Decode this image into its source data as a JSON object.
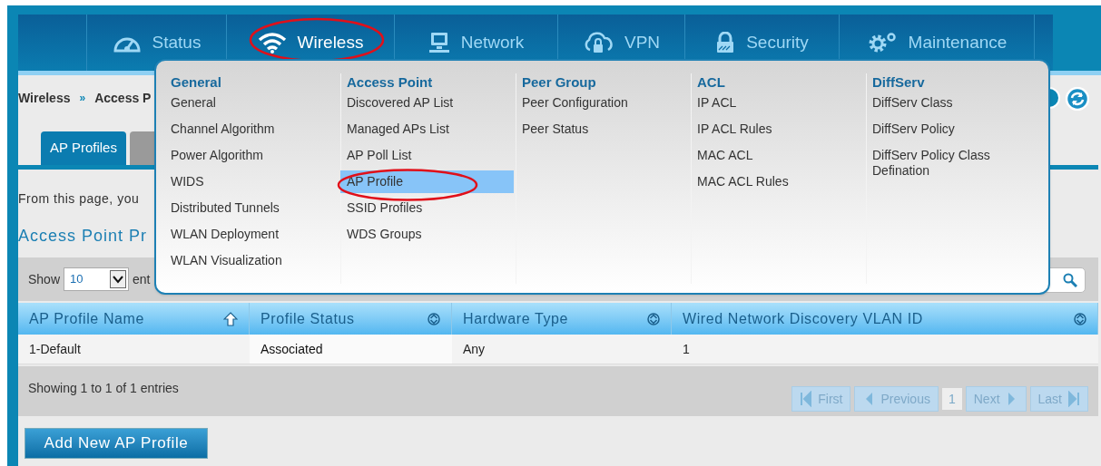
{
  "nav": [
    {
      "label": "Status",
      "selected": false,
      "circled": false
    },
    {
      "label": "Wireless",
      "selected": true,
      "circled": true
    },
    {
      "label": "Network",
      "selected": false,
      "circled": false
    },
    {
      "label": "VPN",
      "selected": false,
      "circled": false
    },
    {
      "label": "Security",
      "selected": false,
      "circled": false
    },
    {
      "label": "Maintenance",
      "selected": false,
      "circled": false
    }
  ],
  "breadcrumb": [
    "Wireless",
    "»",
    "Access P"
  ],
  "tabs": [
    {
      "label": "AP Profiles",
      "selected": true
    },
    {
      "selected": false
    }
  ],
  "intro": "From this page, you",
  "heading": "Access Point Pr",
  "toolbar": {
    "show_label": "Show",
    "page_size": "10",
    "suffix": "ent"
  },
  "table": {
    "columns": [
      {
        "label": "AP Profile Name",
        "sorted": true
      },
      {
        "label": "Profile Status",
        "sorted": false
      },
      {
        "label": "Hardware Type",
        "sorted": false
      },
      {
        "label": "Wired Network Discovery VLAN ID",
        "sorted": false
      }
    ],
    "rows": [
      [
        "1-Default",
        "Associated",
        "Any",
        "1"
      ]
    ]
  },
  "footer": {
    "info": "Showing 1 to 1 of 1 entries",
    "pager": [
      {
        "label": "First",
        "kind": "first",
        "disabled": true
      },
      {
        "label": "Previous",
        "kind": "previous",
        "disabled": true
      },
      {
        "label": "1",
        "kind": "page",
        "selected": true
      },
      {
        "label": "Next",
        "kind": "next",
        "disabled": true
      },
      {
        "label": "Last",
        "kind": "last",
        "disabled": true
      }
    ]
  },
  "add_button": "Add New AP Profile",
  "menu": {
    "columns": [
      {
        "title": "General",
        "items": [
          {
            "label": "General",
            "selected": false,
            "circled": false
          },
          {
            "label": "Channel Algorithm",
            "selected": false,
            "circled": false
          },
          {
            "label": "Power Algorithm",
            "selected": false,
            "circled": false
          },
          {
            "label": "WIDS",
            "selected": false,
            "circled": false
          },
          {
            "label": "Distributed Tunnels",
            "selected": false,
            "circled": false
          },
          {
            "label": "WLAN Deployment",
            "selected": false,
            "circled": false
          },
          {
            "label": "WLAN Visualization",
            "selected": false,
            "circled": false
          }
        ]
      },
      {
        "title": "Access Point",
        "items": [
          {
            "label": "Discovered AP List",
            "selected": false,
            "circled": false
          },
          {
            "label": "Managed APs List",
            "selected": false,
            "circled": false
          },
          {
            "label": "AP Poll List",
            "selected": false,
            "circled": false
          },
          {
            "label": "AP Profile",
            "selected": true,
            "circled": true
          },
          {
            "label": "SSID Profiles",
            "selected": false,
            "circled": false
          },
          {
            "label": "WDS Groups",
            "selected": false,
            "circled": false
          }
        ]
      },
      {
        "title": "Peer Group",
        "items": [
          {
            "label": "Peer Configuration",
            "selected": false,
            "circled": false
          },
          {
            "label": "Peer Status",
            "selected": false,
            "circled": false
          }
        ]
      },
      {
        "title": "ACL",
        "items": [
          {
            "label": "IP ACL",
            "selected": false,
            "circled": false
          },
          {
            "label": "IP ACL Rules",
            "selected": false,
            "circled": false
          },
          {
            "label": "MAC ACL",
            "selected": false,
            "circled": false
          },
          {
            "label": "MAC ACL Rules",
            "selected": false,
            "circled": false
          }
        ]
      },
      {
        "title": "DiffServ",
        "items": [
          {
            "label": "DiffServ Class",
            "selected": false,
            "circled": false
          },
          {
            "label": "DiffServ Policy",
            "selected": false,
            "circled": false
          },
          {
            "label": "DiffServ Policy Class Defination",
            "selected": false,
            "circled": false
          }
        ]
      }
    ]
  }
}
